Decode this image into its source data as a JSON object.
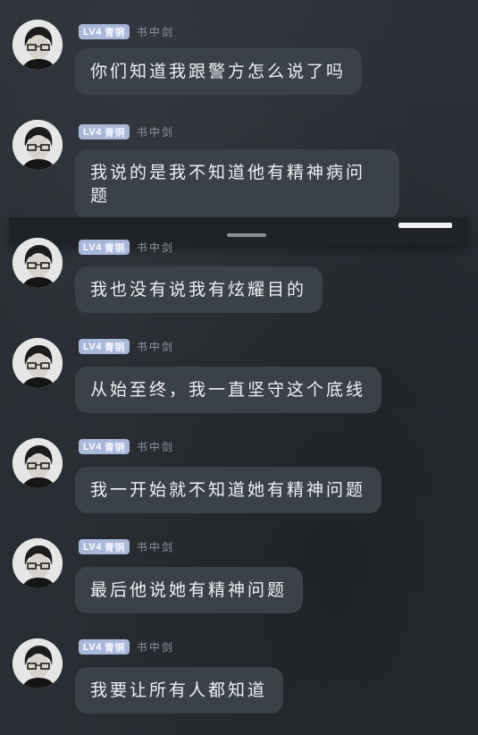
{
  "messages": [
    {
      "level": "LV4",
      "rank": "青铜",
      "user": "书中剑",
      "text": "你们知道我跟警方怎么说了吗"
    },
    {
      "level": "LV4",
      "rank": "青铜",
      "user": "书中剑",
      "text": "我说的是我不知道他有精神病问题"
    },
    {
      "level": "LV4",
      "rank": "青铜",
      "user": "书中剑",
      "text": "我也没有说我有炫耀目的"
    },
    {
      "level": "LV4",
      "rank": "青铜",
      "user": "书中剑",
      "text": "从始至终，我一直坚守这个底线"
    },
    {
      "level": "LV4",
      "rank": "青铜",
      "user": "书中剑",
      "text": "我一开始就不知道她有精神问题"
    },
    {
      "level": "LV4",
      "rank": "青铜",
      "user": "书中剑",
      "text": "最后他说她有精神问题"
    },
    {
      "level": "LV4",
      "rank": "青铜",
      "user": "书中剑",
      "text": "我要让所有人都知道"
    }
  ],
  "colors": {
    "background": "#2a2f36",
    "bubble": "#3b4149",
    "badge": "#a9b7d8",
    "username": "#8d96a3"
  },
  "icons": {
    "avatar": "avatar-icon",
    "sheet_handle": "drag-handle-icon"
  }
}
